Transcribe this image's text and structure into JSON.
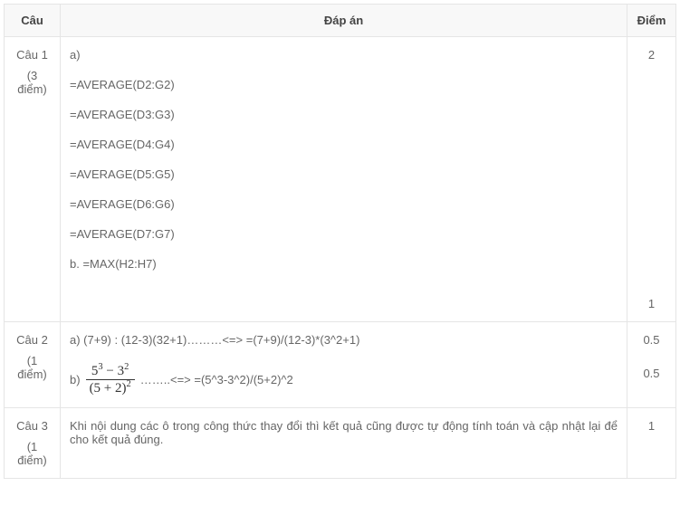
{
  "headers": {
    "cau": "Câu",
    "dapan": "Đáp án",
    "diem": "Điểm"
  },
  "rows": [
    {
      "cau_label": "Câu 1",
      "cau_note": "(3 điểm)",
      "answers": {
        "a_label": "a)",
        "lines": [
          "=AVERAGE(D2:G2)",
          "=AVERAGE(D3:G3)",
          "=AVERAGE(D4:G4)",
          "=AVERAGE(D5:G5)",
          "=AVERAGE(D6:G6)",
          "=AVERAGE(D7:G7)"
        ],
        "b_line": "b. =MAX(H2:H7)"
      },
      "scores": [
        "2",
        "1"
      ]
    },
    {
      "cau_label": "Câu 2",
      "cau_note": "(1 điểm)",
      "answers": {
        "line_a": "a) (7+9) : (12-3)(32+1)………<=> =(7+9)/(12-3)*(3^2+1)",
        "b_prefix": "b)",
        "frac_num": "5³ − 3²",
        "frac_den": "(5 + 2)²",
        "b_suffix": " ……..<=> =(5^3-3^2)/(5+2)^2"
      },
      "scores": [
        "0.5",
        "0.5"
      ]
    },
    {
      "cau_label": "Câu 3",
      "cau_note": "(1 điểm)",
      "answers": {
        "text": "Khi nội dung các ô trong công thức thay đổi thì kết quả cũng được tự động tính toán và cập nhật lại để cho kết quả đúng."
      },
      "scores": [
        "1"
      ]
    }
  ]
}
